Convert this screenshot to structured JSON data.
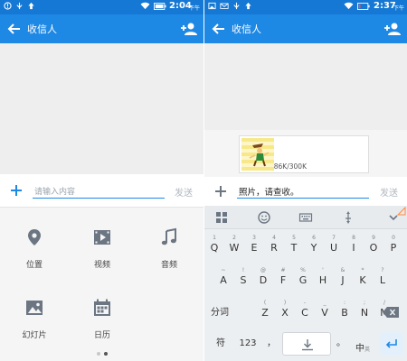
{
  "colors": {
    "statusbar": "#1478d4",
    "appbar": "#1e88e5",
    "accent": "#1e88e5",
    "conversation_bg": "#eeeeee",
    "send_disabled": "#b0b8c0"
  },
  "left": {
    "status": {
      "time": "2:04",
      "period": "下午"
    },
    "appbar": {
      "title": "收信人",
      "back_icon": "arrow-left-icon",
      "action_icon": "add-contact-icon"
    },
    "composer": {
      "placeholder": "请输入内容",
      "send_label": "发送",
      "attach_icon": "plus-icon"
    },
    "attachments": [
      {
        "label": "位置",
        "icon": "location-pin-icon"
      },
      {
        "label": "视频",
        "icon": "video-icon"
      },
      {
        "label": "音频",
        "icon": "music-note-icon"
      },
      {
        "label": "幻灯片",
        "icon": "slideshow-icon"
      },
      {
        "label": "日历",
        "icon": "calendar-icon"
      }
    ],
    "pager": {
      "pages": 2,
      "active": 2
    }
  },
  "right": {
    "status": {
      "time": "2:37",
      "period": "下午"
    },
    "appbar": {
      "title": "收信人",
      "back_icon": "arrow-left-icon",
      "action_icon": "add-contact-icon"
    },
    "photo": {
      "size": "86K/300K"
    },
    "composer": {
      "value": "照片，请查收。",
      "send_label": "发送",
      "attach_icon": "plus-icon"
    },
    "keyboard": {
      "toolbar_icons": [
        "grid-menu-icon",
        "emoji-icon",
        "keyboard-icon",
        "cursor-move-icon",
        "chevron-down-icon"
      ],
      "row1": [
        {
          "k": "Q",
          "s": "1"
        },
        {
          "k": "W",
          "s": "2"
        },
        {
          "k": "E",
          "s": "3"
        },
        {
          "k": "R",
          "s": "4"
        },
        {
          "k": "T",
          "s": "5"
        },
        {
          "k": "Y",
          "s": "6"
        },
        {
          "k": "U",
          "s": "7"
        },
        {
          "k": "I",
          "s": "8"
        },
        {
          "k": "O",
          "s": "9"
        },
        {
          "k": "P",
          "s": "0"
        }
      ],
      "row2": [
        {
          "k": "A",
          "s": "~"
        },
        {
          "k": "S",
          "s": "!"
        },
        {
          "k": "D",
          "s": "@"
        },
        {
          "k": "F",
          "s": "#"
        },
        {
          "k": "G",
          "s": "%"
        },
        {
          "k": "H",
          "s": "'"
        },
        {
          "k": "J",
          "s": "&"
        },
        {
          "k": "K",
          "s": "*"
        },
        {
          "k": "L",
          "s": "?"
        }
      ],
      "row3": [
        {
          "k": "Z",
          "s": "("
        },
        {
          "k": "X",
          "s": ")"
        },
        {
          "k": "C",
          "s": "-"
        },
        {
          "k": "V",
          "s": "_"
        },
        {
          "k": "B",
          "s": ":"
        },
        {
          "k": "N",
          "s": ";"
        },
        {
          "k": "M",
          "s": "/"
        }
      ],
      "fenci": "分词",
      "symbols": "符",
      "numbers": "123",
      "comma": "，",
      "period": "。",
      "lang_main": "中",
      "lang_sub": "英"
    }
  }
}
